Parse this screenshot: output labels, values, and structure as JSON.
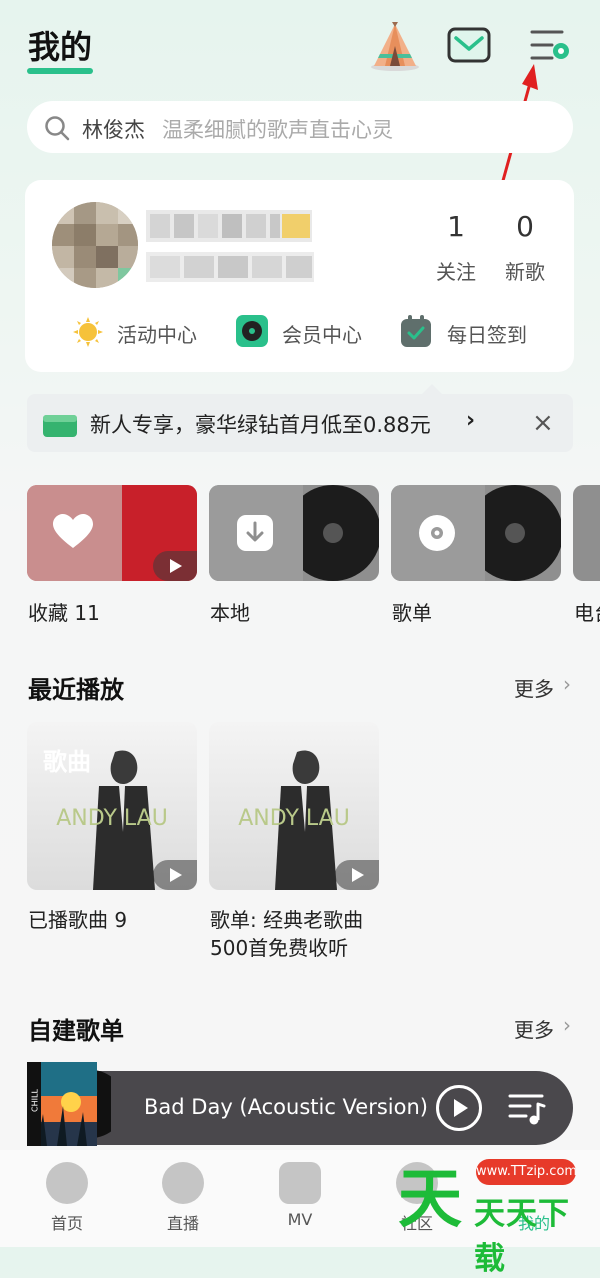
{
  "header": {
    "title": "我的"
  },
  "search": {
    "keyword": "林俊杰",
    "hint": "温柔细腻的歌声直击心灵"
  },
  "profile": {
    "stats": [
      {
        "value": "1",
        "label": "关注"
      },
      {
        "value": "0",
        "label": "新歌"
      }
    ],
    "shortcuts": [
      {
        "label": "活动中心",
        "icon": "sun-icon"
      },
      {
        "label": "会员中心",
        "icon": "vinyl-player-icon"
      },
      {
        "label": "每日签到",
        "icon": "calendar-check-icon"
      }
    ]
  },
  "promo": {
    "text": "新人专享，豪华绿钻首月低至0.88元",
    "arrow": "›",
    "close": "×"
  },
  "tiles": [
    {
      "label": "收藏 11"
    },
    {
      "label": "本地"
    },
    {
      "label": "歌单"
    },
    {
      "label": "电台"
    }
  ],
  "recent": {
    "title": "最近播放",
    "more": "更多",
    "more_chevron": "›",
    "items": [
      {
        "overlay": "歌曲",
        "cover_text": "ANDY LAU",
        "label_line1": "已播歌曲 9",
        "label_line2": ""
      },
      {
        "overlay": "",
        "cover_text": "ANDY LAU",
        "label_line1": "歌单: 经典老歌曲",
        "label_line2": "500首免费收听"
      }
    ]
  },
  "custom": {
    "title": "自建歌单",
    "more": "更多",
    "more_chevron": "›"
  },
  "player": {
    "title": "Bad Day (Acoustic Version)",
    "art_label": "CHILL"
  },
  "tabbar": [
    {
      "label": "首页"
    },
    {
      "label": "直播"
    },
    {
      "label": "MV"
    },
    {
      "label": "社区"
    },
    {
      "label": "我的"
    }
  ],
  "watermark": {
    "big": "天",
    "site": "www.TTzip.com",
    "text": "天天下载"
  },
  "colors": {
    "accent": "#2ac08b",
    "annotation_arrow": "#e02020",
    "player_bg": "#4a484c",
    "watermark_green": "#1dbb38"
  }
}
